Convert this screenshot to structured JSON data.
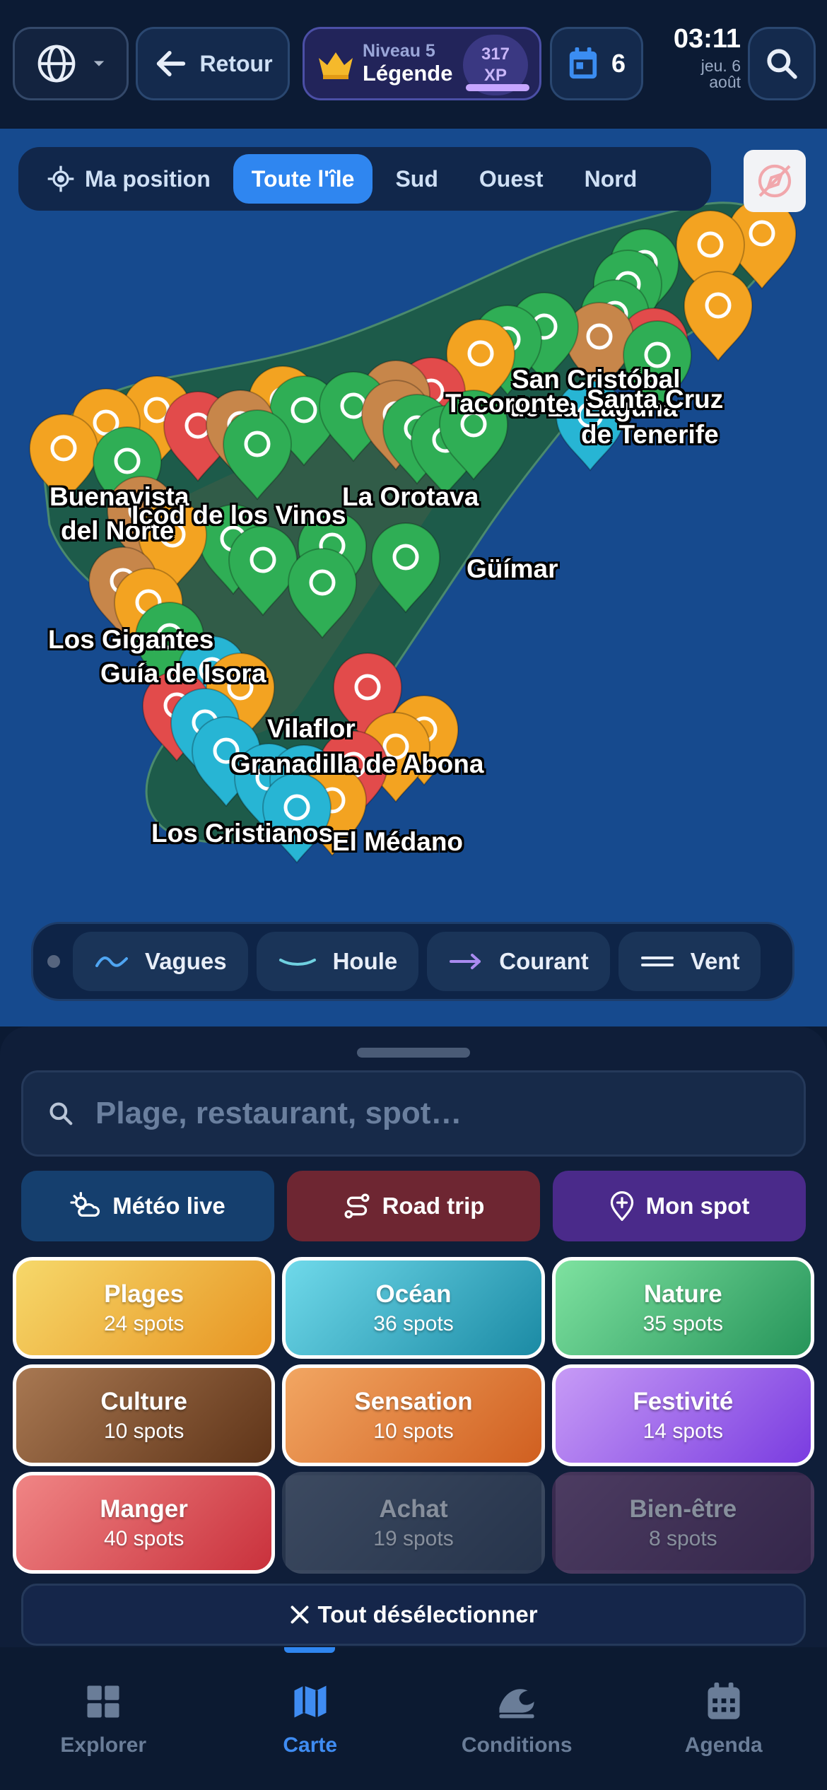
{
  "header": {
    "back_label": "Retour",
    "level_label": "Niveau 5",
    "level_title": "Légende",
    "xp_value": "317",
    "xp_unit": "XP",
    "xp_progress": 0.9,
    "agenda_count": "6",
    "clock_time": "03:11",
    "clock_day": "jeu. 6",
    "clock_month": "août"
  },
  "map": {
    "zones": [
      {
        "label": "Ma position",
        "active": false
      },
      {
        "label": "Toute l'île",
        "active": true
      },
      {
        "label": "Sud",
        "active": false
      },
      {
        "label": "Ouest",
        "active": false
      },
      {
        "label": "Nord",
        "active": false
      }
    ],
    "places": [
      "San Cristóbal",
      "de La Laguna",
      "Tacoronte",
      "Santa Cruz",
      "de Tenerife",
      "Buenavista",
      "del Norte",
      "Icod de los Vinos",
      "La Orotava",
      "Güímar",
      "Los Gigantes",
      "Guía de Isora",
      "Vilaflor",
      "Granadilla de Abona",
      "Los Cristianos",
      "El Médano"
    ],
    "legend": [
      "Vagues",
      "Houle",
      "Courant",
      "Vent"
    ],
    "colors": {
      "beach": "#f3a321",
      "nature": "#2fae55",
      "food": "#e24b4b",
      "ocean": "#27b5d4",
      "culture": "#c7864a"
    }
  },
  "sheet": {
    "search_placeholder": "Plage, restaurant, spot…",
    "actions": [
      "Météo live",
      "Road trip",
      "Mon spot"
    ],
    "categories": [
      {
        "name": "Plages",
        "count": "24 spots",
        "selected": true
      },
      {
        "name": "Océan",
        "count": "36 spots",
        "selected": true
      },
      {
        "name": "Nature",
        "count": "35 spots",
        "selected": true
      },
      {
        "name": "Culture",
        "count": "10 spots",
        "selected": true
      },
      {
        "name": "Sensation",
        "count": "10 spots",
        "selected": true
      },
      {
        "name": "Festivité",
        "count": "14 spots",
        "selected": true
      },
      {
        "name": "Manger",
        "count": "40 spots",
        "selected": true
      },
      {
        "name": "Achat",
        "count": "19 spots",
        "selected": false
      },
      {
        "name": "Bien-être",
        "count": "8 spots",
        "selected": false
      }
    ],
    "deselect_label": "Tout désélectionner"
  },
  "nav": {
    "items": [
      {
        "label": "Explorer",
        "icon": "grid-icon",
        "active": false
      },
      {
        "label": "Carte",
        "icon": "map-icon",
        "active": true
      },
      {
        "label": "Conditions",
        "icon": "wave-icon",
        "active": false
      },
      {
        "label": "Agenda",
        "icon": "calendar-icon",
        "active": false
      }
    ]
  }
}
